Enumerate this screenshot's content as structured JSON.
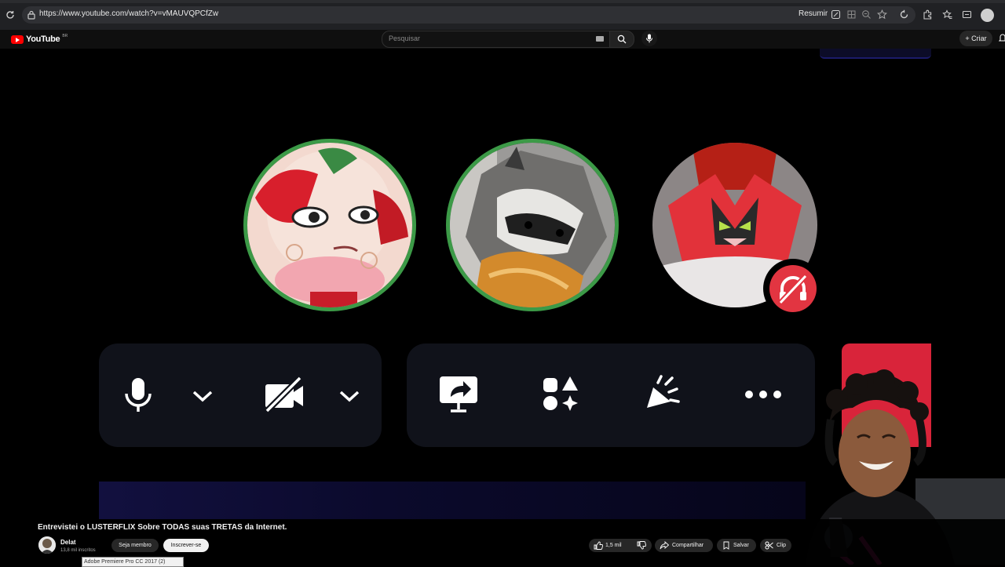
{
  "browser": {
    "url": "https://www.youtube.com/watch?v=vMAUVQPCfZw",
    "summarize_label": "Resumir",
    "icons": [
      "reload-icon",
      "lock-icon",
      "reading-icon",
      "grid-icon",
      "zoom-icon",
      "star-icon",
      "refresh-icon",
      "extensions-icon",
      "favorites-icon",
      "collections-icon",
      "profile-icon"
    ]
  },
  "youtube_header": {
    "logo_text": "YouTube",
    "region": "BR",
    "search_placeholder": "Pesquisar",
    "create_label": "Criar"
  },
  "video_scene": {
    "participants": [
      {
        "name": "pink-anime-avatar",
        "speaking": true
      },
      {
        "name": "raccoon-avatar",
        "speaking": true
      },
      {
        "name": "red-cat-avatar",
        "speaking": false,
        "deafened": true
      }
    ],
    "call_controls": [
      "microphone",
      "mic-options",
      "camera-off",
      "camera-options",
      "screen-share",
      "activities",
      "soundboard",
      "more-options"
    ],
    "colors": {
      "speaking_ring": "#3c9a47",
      "danger": "#d9243a",
      "panel": "#10121a"
    }
  },
  "video_info": {
    "title": "Entrevistei o LUSTERFLIX Sobre TODAS suas TRETAS da Internet.",
    "channel": "Delat",
    "subscribers": "13,8 mil inscritos",
    "member_label": "Seja membro",
    "subscribe_label": "Inscrever-se",
    "likes": "1,5 mil",
    "share_label": "Compartilhar",
    "save_label": "Salvar",
    "clip_label": "Clip",
    "tooltip": "Adobe Premiere Pro CC 2017 (2)"
  }
}
